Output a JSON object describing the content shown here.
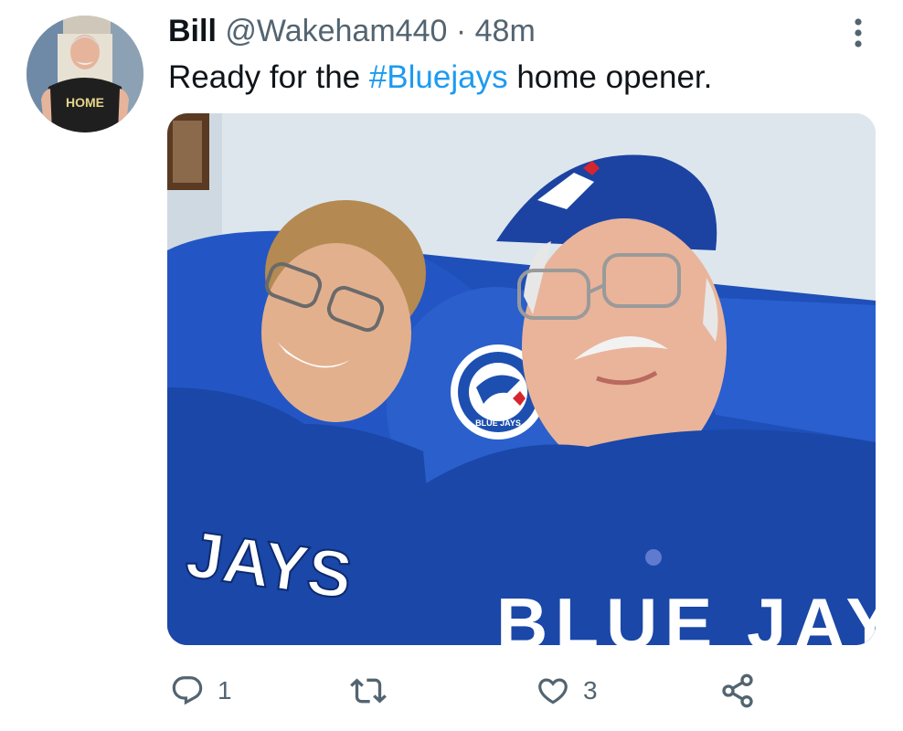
{
  "tweet": {
    "author": {
      "name": "Bill",
      "handle": "@Wakeham440",
      "separator": "·",
      "timestamp": "48m"
    },
    "text_before": "Ready for the ",
    "hashtag": "#Bluejays",
    "text_after": " home opener.",
    "media_text": {
      "avatar_shirt": "HOME",
      "jersey_left": "JAYS",
      "jersey_right": "BLUE JAYS",
      "logo": "BLUE JAYS"
    },
    "actions": {
      "reply_count": "1",
      "retweet_count": "",
      "like_count": "3"
    },
    "colors": {
      "hashtag": "#1d9bf0",
      "secondary_text": "#536471",
      "primary_text": "#0f1419",
      "jersey_blue": "#1a47a8"
    },
    "icons": [
      "more-icon",
      "reply-icon",
      "retweet-icon",
      "like-icon",
      "share-icon"
    ]
  }
}
